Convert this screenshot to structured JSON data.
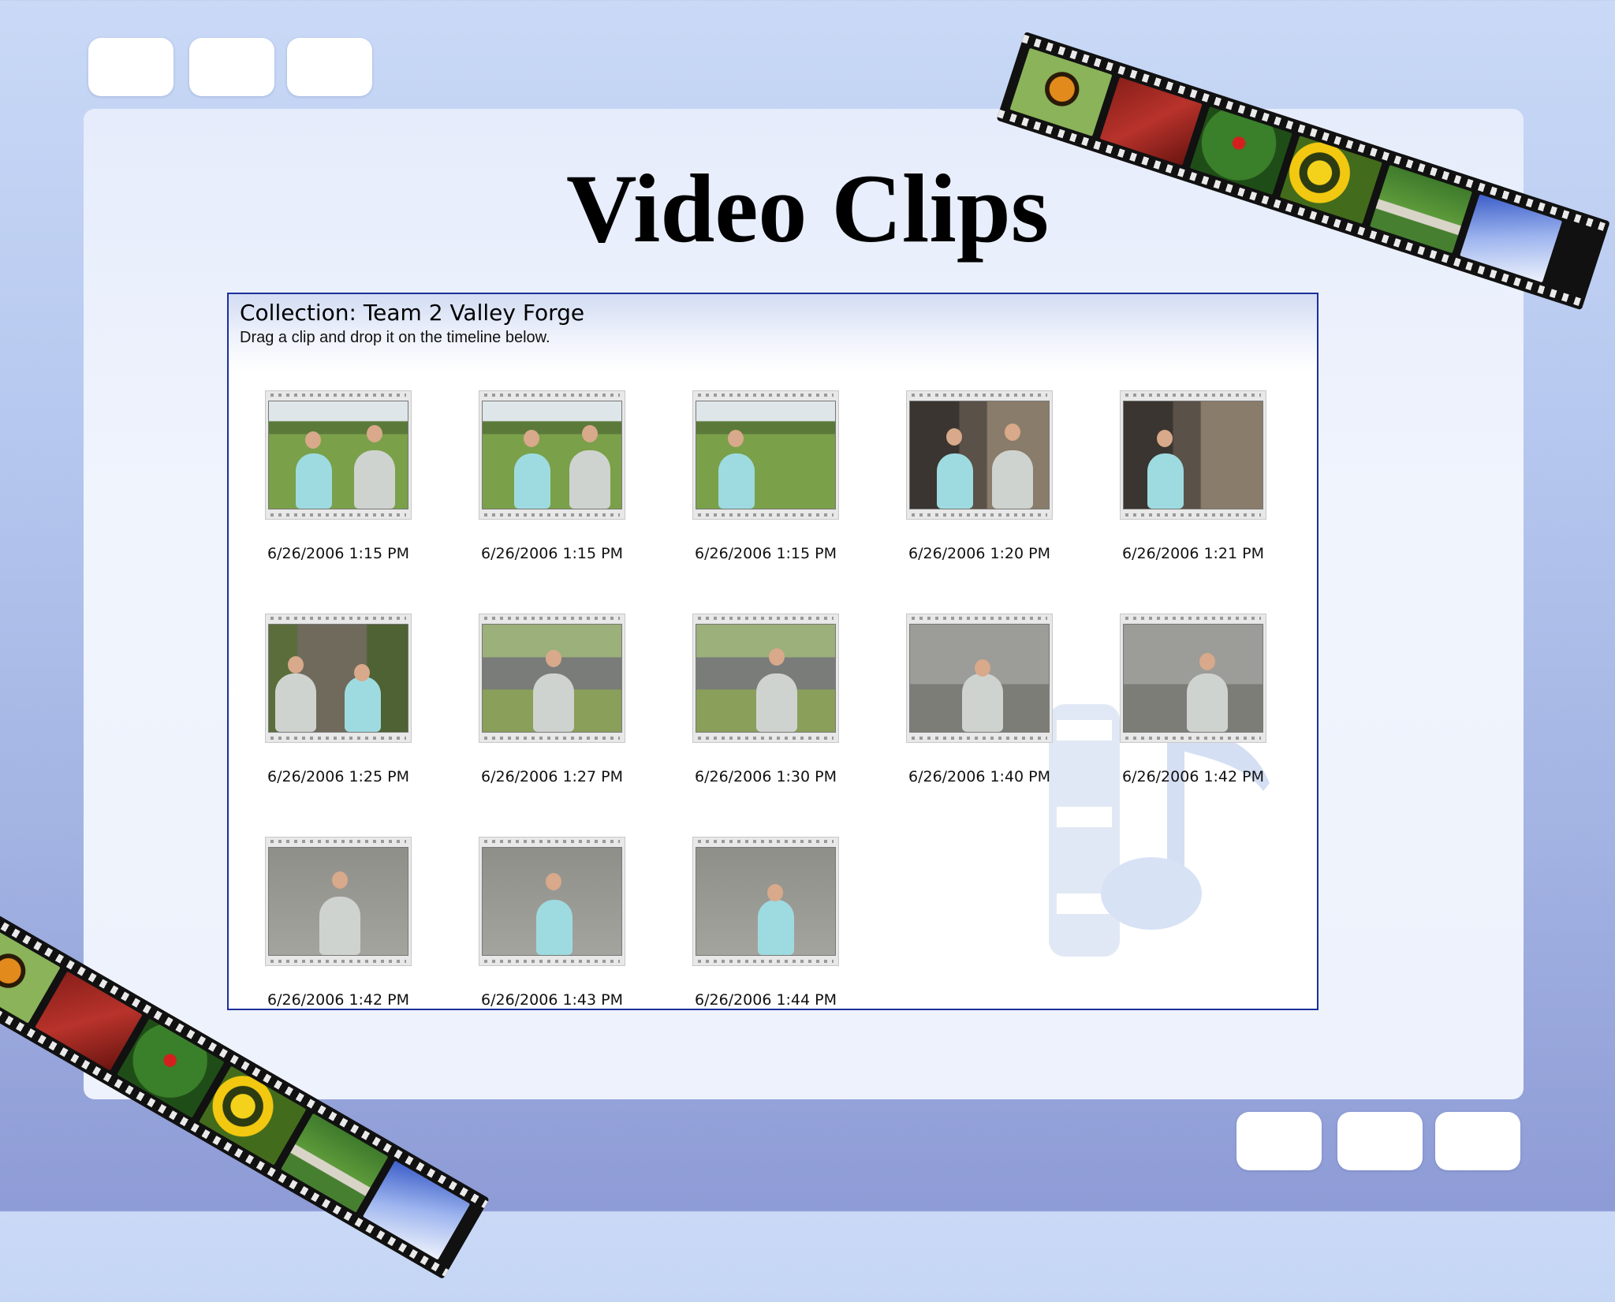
{
  "slide": {
    "title": "Video Clips"
  },
  "window": {
    "collection_title": "Collection: Team 2 Valley Forge",
    "hint": "Drag a clip and drop it on the timeline below."
  },
  "clips": [
    {
      "label": "6/26/2006 1:15 PM"
    },
    {
      "label": "6/26/2006 1:15 PM"
    },
    {
      "label": "6/26/2006 1:15 PM"
    },
    {
      "label": "6/26/2006 1:20 PM"
    },
    {
      "label": "6/26/2006 1:21 PM"
    },
    {
      "label": "6/26/2006 1:25 PM"
    },
    {
      "label": "6/26/2006 1:27 PM"
    },
    {
      "label": "6/26/2006 1:30 PM"
    },
    {
      "label": "6/26/2006 1:40 PM"
    },
    {
      "label": "6/26/2006 1:42 PM"
    },
    {
      "label": "6/26/2006 1:42 PM"
    },
    {
      "label": "6/26/2006 1:43 PM"
    },
    {
      "label": "6/26/2006 1:44 PM"
    }
  ],
  "colors": {
    "window_border": "#1c2f9c",
    "background": "#b6c8ef",
    "panel": "#eef2fc"
  }
}
